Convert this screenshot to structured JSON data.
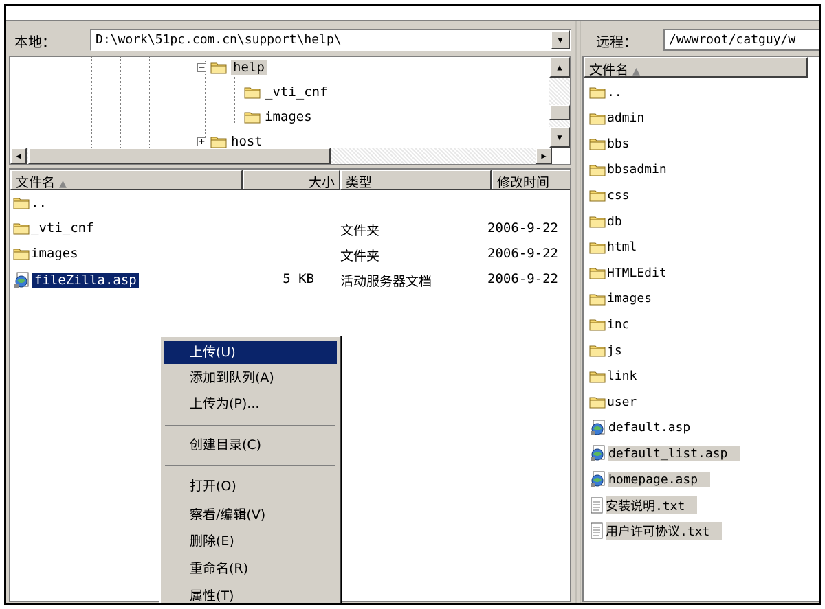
{
  "top_strip_text": "",
  "local": {
    "path_label": "本地：",
    "path_value": "D:\\work\\51pc.com.cn\\support\\help\\",
    "tree": [
      {
        "name": "help",
        "expander": "−",
        "selected": true
      },
      {
        "name": "_vti_cnf",
        "expander": "",
        "selected": false
      },
      {
        "name": "images",
        "expander": "",
        "selected": false
      },
      {
        "name": "host",
        "expander": "+",
        "selected": false
      }
    ],
    "columns": {
      "name": "文件名",
      "size": "大小",
      "type": "类型",
      "modified": "修改时间"
    },
    "files": [
      {
        "name": "..",
        "size": "",
        "type": "",
        "modified": "",
        "icon": "folder-icon"
      },
      {
        "name": "_vti_cnf",
        "size": "",
        "type": "文件夹",
        "modified": "2006-9-22",
        "icon": "folder-icon"
      },
      {
        "name": "images",
        "size": "",
        "type": "文件夹",
        "modified": "2006-9-22",
        "icon": "folder-icon"
      },
      {
        "name": "fileZilla.asp",
        "size": "5 KB",
        "type": "活动服务器文档",
        "modified": "2006-9-22",
        "icon": "asp-file-icon",
        "selected": true
      }
    ]
  },
  "context_menu": {
    "items": [
      {
        "label": "上传(U)",
        "highlighted": true
      },
      {
        "label": "添加到队列(A)"
      },
      {
        "label": "上传为(P)..."
      },
      {
        "label": "创建目录(C)"
      },
      {
        "label": "打开(O)"
      },
      {
        "label": "察看/编辑(V)"
      },
      {
        "label": "删除(E)"
      },
      {
        "label": "重命名(R)"
      },
      {
        "label": "属性(T)"
      }
    ]
  },
  "remote": {
    "path_label": "远程：",
    "path_value": "/wwwroot/catguy/w",
    "column_name": "文件名",
    "files": [
      {
        "name": "..",
        "icon": "folder-icon"
      },
      {
        "name": "admin",
        "icon": "folder-icon"
      },
      {
        "name": "bbs",
        "icon": "folder-icon"
      },
      {
        "name": "bbsadmin",
        "icon": "folder-icon"
      },
      {
        "name": "css",
        "icon": "folder-icon"
      },
      {
        "name": "db",
        "icon": "folder-icon"
      },
      {
        "name": "html",
        "icon": "folder-icon"
      },
      {
        "name": "HTMLEdit",
        "icon": "folder-icon"
      },
      {
        "name": "images",
        "icon": "folder-icon"
      },
      {
        "name": "inc",
        "icon": "folder-icon"
      },
      {
        "name": "js",
        "icon": "folder-icon"
      },
      {
        "name": "link",
        "icon": "folder-icon"
      },
      {
        "name": "user",
        "icon": "folder-icon"
      },
      {
        "name": "default.asp",
        "icon": "asp-file-icon"
      },
      {
        "name": "default_list.asp",
        "icon": "asp-file-icon",
        "shaded": true
      },
      {
        "name": "homepage.asp",
        "icon": "asp-file-icon",
        "shaded": true
      },
      {
        "name": "安装说明.txt",
        "icon": "text-file-icon",
        "shaded": true
      },
      {
        "name": "用户许可协议.txt",
        "icon": "text-file-icon",
        "shaded": true
      }
    ]
  },
  "colors": {
    "selection": "#0a246a",
    "face": "#d4d0c8",
    "folder": "#f5d76e"
  }
}
